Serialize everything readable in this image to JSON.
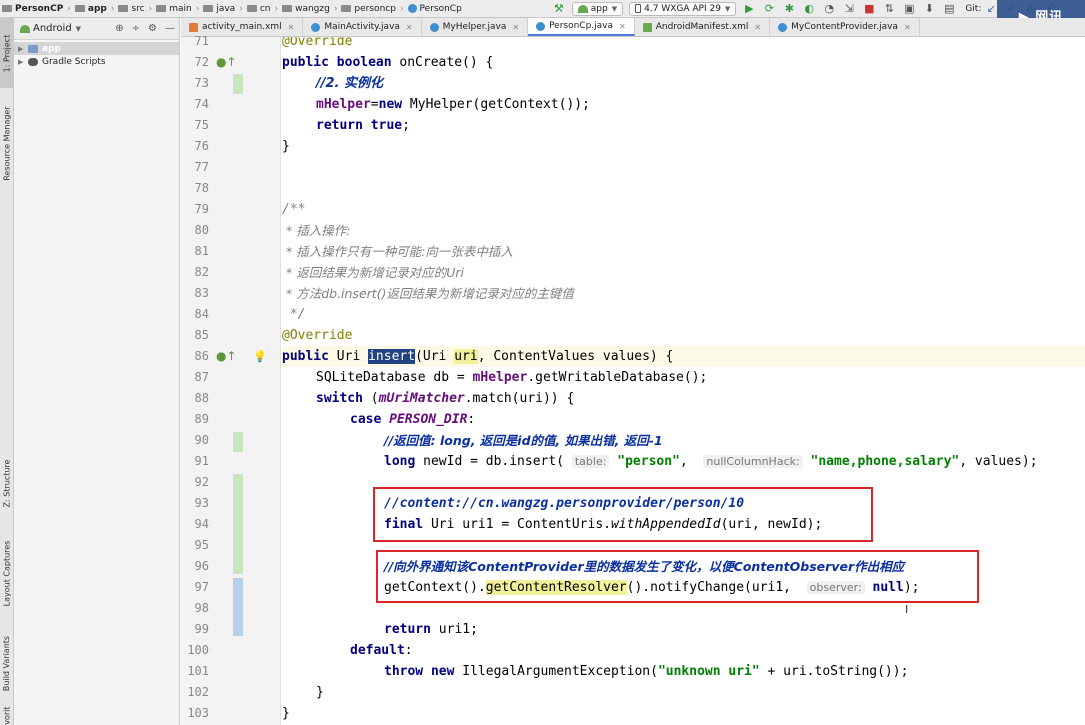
{
  "breadcrumbs": [
    "PersonCP",
    "app",
    "src",
    "main",
    "java",
    "cn",
    "wangzg",
    "personcp",
    "PersonCp"
  ],
  "toolbar": {
    "run_config": "app",
    "device": "4.7  WXGA API 29",
    "git_label": "Git:"
  },
  "left_tabs": [
    "1: Project",
    "Resource Manager",
    "Z: Structure",
    "Layout Captures",
    "Build Variants",
    "Favorites"
  ],
  "project_panel": {
    "view_selector": "Android",
    "tree": [
      "app",
      "Gradle Scripts"
    ]
  },
  "editor_tabs": [
    {
      "label": "activity_main.xml",
      "active": false
    },
    {
      "label": "MainActivity.java",
      "active": false
    },
    {
      "label": "MyHelper.java",
      "active": false
    },
    {
      "label": "PersonCp.java",
      "active": true
    },
    {
      "label": "AndroidManifest.xml",
      "active": false
    },
    {
      "label": "MyContentProvider.java",
      "active": false
    }
  ],
  "line_numbers": [
    "71",
    "72",
    "73",
    "74",
    "75",
    "76",
    "77",
    "78",
    "79",
    "80",
    "81",
    "82",
    "83",
    "84",
    "85",
    "86",
    "87",
    "88",
    "89",
    "90",
    "91",
    "92",
    "93",
    "94",
    "95",
    "96",
    "97",
    "98",
    "99",
    "100",
    "101",
    "102",
    "103"
  ],
  "code": {
    "l71": "@Override",
    "l72a": "public boolean",
    "l72b": " onCreate() {",
    "l73": "//2. 实例化",
    "l74a": "mHelper",
    "l74b": "=",
    "l74c": "new",
    "l74d": " MyHelper(getContext());",
    "l75a": "return true",
    "l75b": ";",
    "l76": "}",
    "l79": "/**",
    "l80": " * 插入操作:",
    "l81": " * 插入操作只有一种可能:向一张表中插入",
    "l82": " * 返回结果为新增记录对应的Uri",
    "l83": " * 方法db.insert()返回结果为新增记录对应的主键值",
    "l84": " */",
    "l85": "@Override",
    "l86a": "public",
    "l86b": " Uri ",
    "l86c": "insert",
    "l86d": "(Uri ",
    "l86e": "uri",
    "l86f": ", ContentValues values) {",
    "l87a": "SQLiteDatabase db = ",
    "l87b": "mHelper",
    "l87c": ".getWritableDatabase();",
    "l88a": "switch",
    "l88b": " (",
    "l88c": "mUriMatcher",
    "l88d": ".match(uri)) {",
    "l89a": "case ",
    "l89b": "PERSON_DIR",
    "l89c": ":",
    "l90": "//返回值: long, 返回是id的值, 如果出错, 返回-1",
    "l91a": "long",
    "l91b": " newId = db.insert( ",
    "l91h1": "table:",
    "l91s1": " \"person\"",
    "l91c": ",  ",
    "l91h2": "nullColumnHack:",
    "l91s2": " \"name,phone,salary\"",
    "l91d": ", values);",
    "l93": "//content://cn.wangzg.personprovider/person/10",
    "l94a": "final",
    "l94b": " Uri uri1 = ContentUris.",
    "l94c": "withAppendedId",
    "l94d": "(uri, newId);",
    "l96": "//向外界通知该ContentProvider里的数据发生了变化，以便ContentObserver作出相应",
    "l97a": "getContext().",
    "l97b": "getContentResolver",
    "l97c": "().notifyChange(uri1,  ",
    "l97h": "observer:",
    "l97d": " null",
    "l97e": ");",
    "l99a": "return",
    "l99b": " uri1;",
    "l100a": "default",
    "l100b": ":",
    "l101a": "throw new",
    "l101b": " IllegalArgumentException(",
    "l101s": "\"unknown uri\"",
    "l101c": " + uri.toString());",
    "l102": "}",
    "l103": "}"
  },
  "colors": {
    "keyword": "#000080",
    "string": "#008000",
    "comment": "#808080",
    "annotation_box": "#d9262a",
    "selection": "#214283"
  }
}
